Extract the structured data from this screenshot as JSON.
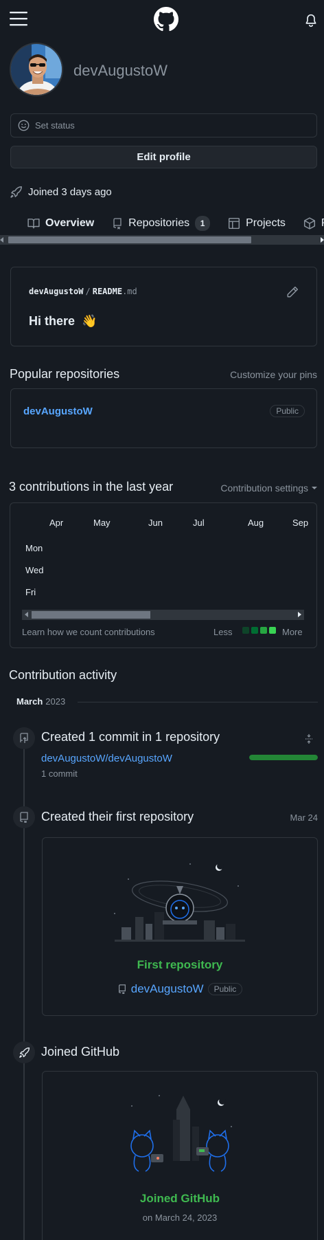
{
  "header": {
    "menu_icon": "hamburger-icon",
    "logo_icon": "github-logo-icon",
    "bell_icon": "bell-icon"
  },
  "profile": {
    "username": "devAugustoW",
    "set_status": "Set status",
    "edit_profile": "Edit profile",
    "joined": "Joined 3 days ago"
  },
  "tabs": [
    {
      "label": "Overview",
      "icon": "book-icon"
    },
    {
      "label": "Repositories",
      "icon": "repo-icon",
      "count": "1"
    },
    {
      "label": "Projects",
      "icon": "table-icon"
    },
    {
      "label": "Pa",
      "icon": "package-icon"
    }
  ],
  "readme": {
    "owner": "devAugustoW",
    "sep": "/",
    "file": "README",
    "ext": ".md",
    "heading": "Hi there",
    "emoji": "👋"
  },
  "popular": {
    "title": "Popular repositories",
    "customize": "Customize your pins",
    "repo": {
      "name": "devAugustoW",
      "visibility": "Public"
    }
  },
  "contributions": {
    "title": "3 contributions in the last year",
    "settings": "Contribution settings",
    "months": [
      "Apr",
      "May",
      "Jun",
      "Jul",
      "Aug",
      "Sep"
    ],
    "days": [
      "Mon",
      "Wed",
      "Fri"
    ],
    "learn": "Learn how we count contributions",
    "less": "Less",
    "more": "More",
    "legend_colors": [
      "#0e4429",
      "#006d32",
      "#26a641",
      "#39d353"
    ]
  },
  "activity": {
    "title": "Contribution activity",
    "month": "March",
    "year": "2023",
    "commits": {
      "title": "Created 1 commit in 1 repository",
      "repo": "devAugustoW/devAugustoW",
      "count": "1 commit",
      "progress": 1.0
    },
    "first_repo": {
      "title": "Created their first repository",
      "date": "Mar 24",
      "card_title": "First repository",
      "repo": "devAugustoW",
      "visibility": "Public"
    },
    "joined": {
      "title": "Joined GitHub",
      "card_title": "Joined GitHub",
      "date": "on March 24, 2023"
    }
  }
}
